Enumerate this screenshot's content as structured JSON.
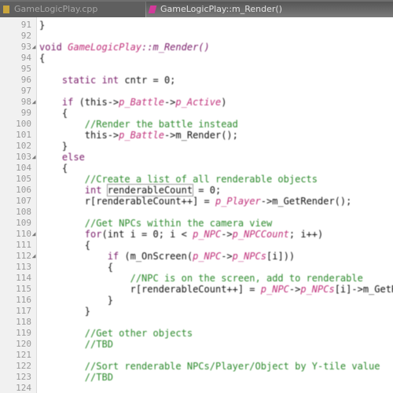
{
  "tabs": [
    {
      "label": "GameLogicPlay.cpp",
      "icon": "cpp-file-icon"
    },
    {
      "label": "GameLogicPlay::m_Render()",
      "icon": "function-icon"
    }
  ],
  "line_numbers": [
    "91",
    "92",
    "93",
    "94",
    "95",
    "96",
    "97",
    "98",
    "99",
    "100",
    "101",
    "102",
    "103",
    "104",
    "105",
    "106",
    "107",
    "108",
    "109",
    "110",
    "111",
    "112",
    "113",
    "114",
    "115",
    "116",
    "117",
    "118",
    "119",
    "120",
    "121",
    "122",
    "123",
    "124",
    "125"
  ],
  "code_lines": [
    [
      {
        "t": "}",
        "c": "pl"
      }
    ],
    [],
    [
      {
        "t": "void ",
        "c": "kw"
      },
      {
        "t": "GameLogicPlay",
        "c": "nm"
      },
      {
        "t": "::m_Render()",
        "c": "fn"
      }
    ],
    [
      {
        "t": "{",
        "c": "pl"
      }
    ],
    [],
    [
      {
        "t": "    static int ",
        "c": "kw"
      },
      {
        "t": "cntr ",
        "c": "pl"
      },
      {
        "t": "= 0;",
        "c": "pl"
      }
    ],
    [],
    [
      {
        "t": "    if ",
        "c": "kw"
      },
      {
        "t": "(this->",
        "c": "pl"
      },
      {
        "t": "p_Battle",
        "c": "nm"
      },
      {
        "t": "->",
        "c": "pl"
      },
      {
        "t": "p_Active",
        "c": "nm"
      },
      {
        "t": ")",
        "c": "pl"
      }
    ],
    [
      {
        "t": "    {",
        "c": "pl"
      }
    ],
    [
      {
        "t": "        //Render the battle instead",
        "c": "cm"
      }
    ],
    [
      {
        "t": "        this->",
        "c": "pl"
      },
      {
        "t": "p_Battle",
        "c": "nm"
      },
      {
        "t": "->m_Render();",
        "c": "pl"
      }
    ],
    [
      {
        "t": "    }",
        "c": "pl"
      }
    ],
    [
      {
        "t": "    else",
        "c": "kw"
      }
    ],
    [
      {
        "t": "    {",
        "c": "pl"
      }
    ],
    [
      {
        "t": "        //Create a list of all renderable objects",
        "c": "cm"
      }
    ],
    [
      {
        "t": "        int ",
        "c": "kw"
      },
      {
        "t": "renderableCount",
        "c": "pl",
        "box": true
      },
      {
        "t": " = 0;",
        "c": "pl"
      }
    ],
    [
      {
        "t": "        r[renderableCount++] = ",
        "c": "pl"
      },
      {
        "t": "p_Player",
        "c": "nm"
      },
      {
        "t": "->m_GetRender();",
        "c": "pl"
      }
    ],
    [],
    [
      {
        "t": "        //Get NPCs within the camera view",
        "c": "cm"
      }
    ],
    [
      {
        "t": "        for",
        "c": "kw"
      },
      {
        "t": "(int i = 0; i < ",
        "c": "pl"
      },
      {
        "t": "p_NPC",
        "c": "nm"
      },
      {
        "t": "->",
        "c": "pl"
      },
      {
        "t": "p_NPCCount",
        "c": "nm"
      },
      {
        "t": "; i++)",
        "c": "pl"
      }
    ],
    [
      {
        "t": "        {",
        "c": "pl"
      }
    ],
    [
      {
        "t": "            if ",
        "c": "kw"
      },
      {
        "t": "(m_OnScreen(",
        "c": "pl"
      },
      {
        "t": "p_NPC",
        "c": "nm"
      },
      {
        "t": "->",
        "c": "pl"
      },
      {
        "t": "p_NPCs",
        "c": "nm"
      },
      {
        "t": "[i]))",
        "c": "pl"
      }
    ],
    [
      {
        "t": "            {",
        "c": "pl"
      }
    ],
    [
      {
        "t": "                //NPC is on the screen, add to renderable",
        "c": "cm"
      }
    ],
    [
      {
        "t": "                r[renderableCount++] = ",
        "c": "pl"
      },
      {
        "t": "p_NPC",
        "c": "nm"
      },
      {
        "t": "->",
        "c": "pl"
      },
      {
        "t": "p_NPCs",
        "c": "nm"
      },
      {
        "t": "[i]->m_GetRender();",
        "c": "pl"
      }
    ],
    [
      {
        "t": "            }",
        "c": "pl"
      }
    ],
    [
      {
        "t": "        }",
        "c": "pl"
      }
    ],
    [],
    [
      {
        "t": "        //Get other objects",
        "c": "cm"
      }
    ],
    [
      {
        "t": "        //TBD",
        "c": "cm"
      }
    ],
    [],
    [
      {
        "t": "        //Sort renderable NPCs/Player/Object by Y-tile value",
        "c": "cm"
      }
    ],
    [
      {
        "t": "        //TBD",
        "c": "cm"
      }
    ]
  ],
  "fold_markers": {
    "2": "triangle",
    "7": "triangle",
    "12": "triangle",
    "19": "triangle",
    "21": "triangle"
  },
  "colors": {
    "keyword": "#7a1c6a",
    "member": "#c0307a",
    "comment": "#2c8a2c",
    "tabbar": "#6d6d6d"
  }
}
